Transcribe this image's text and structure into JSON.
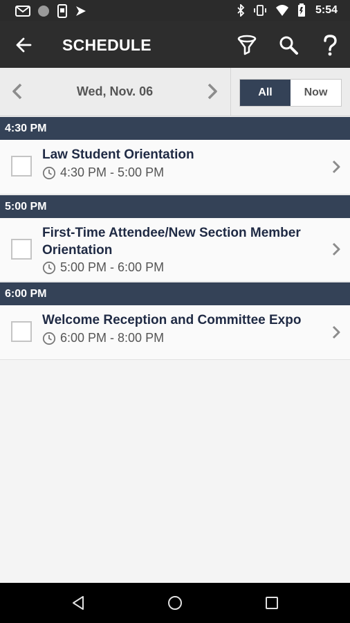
{
  "status_bar": {
    "left_icons": [
      "gmail-icon",
      "circle-icon",
      "phone-icon",
      "flag-icon"
    ],
    "right_icons": [
      "bluetooth-icon",
      "vibrate-icon",
      "wifi-icon",
      "battery-icon"
    ],
    "time": "5:54"
  },
  "app_bar": {
    "title": "SCHEDULE",
    "actions": [
      "filter-icon",
      "search-icon",
      "help-icon"
    ]
  },
  "date_nav": {
    "date": "Wed, Nov. 06",
    "segments": [
      {
        "label": "All",
        "active": true
      },
      {
        "label": "Now",
        "active": false
      }
    ]
  },
  "sections": [
    {
      "header": "4:30  PM",
      "events": [
        {
          "title": "Law Student Orientation",
          "time": "4:30 PM - 5:00 PM"
        }
      ]
    },
    {
      "header": "5:00  PM",
      "events": [
        {
          "title": "First-Time Attendee/New Section Member Orientation",
          "time": "5:00 PM - 6:00 PM"
        }
      ]
    },
    {
      "header": "6:00  PM",
      "events": [
        {
          "title": "Welcome Reception and Committee Expo",
          "time": "6:00 PM - 8:00 PM"
        }
      ]
    }
  ],
  "colors": {
    "header_bg": "#2d2d2d",
    "section_bg": "#344257",
    "accent": "#344257",
    "title_text": "#1f2a44"
  },
  "nav_bar": [
    "back-nav-icon",
    "home-nav-icon",
    "recents-nav-icon"
  ]
}
